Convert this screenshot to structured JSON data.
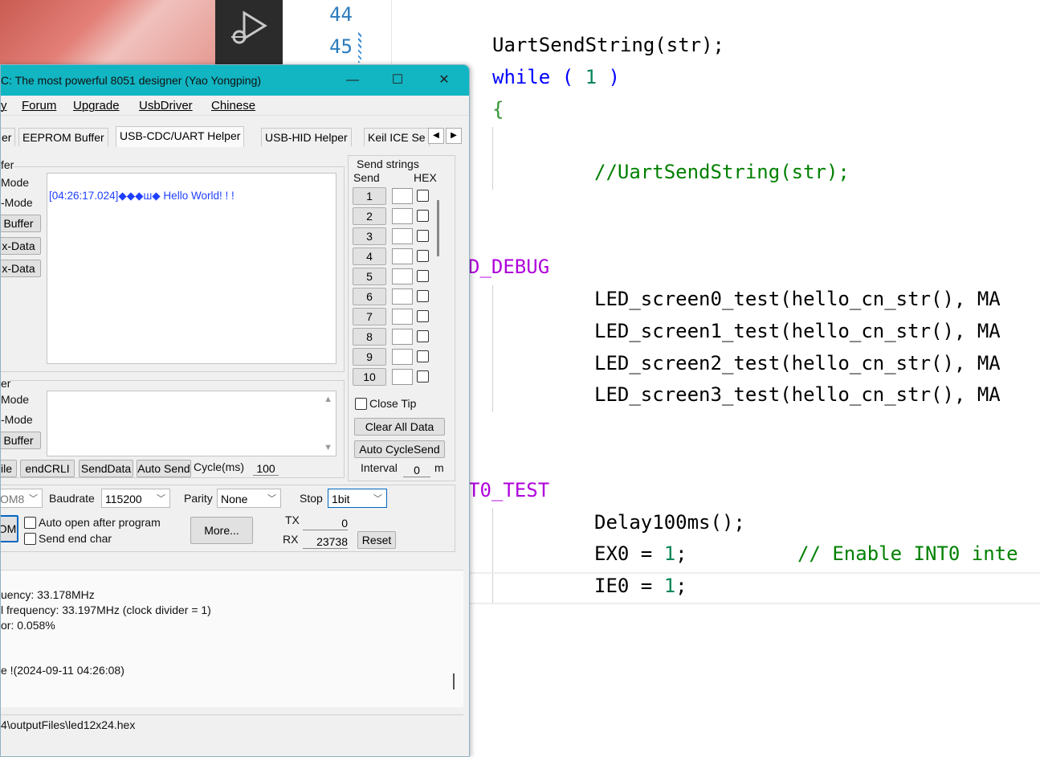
{
  "editor": {
    "gutter": [
      "44",
      "45"
    ],
    "lines": {
      "l1_fn": "UartSendString",
      "l1_arg": "(str);",
      "l2_kw": "while",
      "l2_open": " ( ",
      "l2_num": "1",
      "l2_close": " )",
      "l3_brace": "{",
      "l4_comment": "//UartSendString(str);",
      "l5_macro": "D_DEBUG",
      "l6": "LED_screen0_test",
      "l7": "LED_screen1_test",
      "l8": "LED_screen2_test",
      "l9": "LED_screen3_test",
      "lcall_a": "(hello_cn_str(), MA",
      "l10_macro": "T0_TEST",
      "l11": "Delay100ms();",
      "l12_a": "EX0 = ",
      "l12_num": "1",
      "l12_b": ";",
      "l12_comment": "// Enable INT0 inte",
      "l13_a": "IE0 = ",
      "l13_num": "1",
      "l13_b": ";"
    }
  },
  "window": {
    "title": "C: The most powerful 8051 designer (Yao Yongping)",
    "minimize": "—",
    "maximize": "☐",
    "close": "✕"
  },
  "menu": [
    "y",
    "Forum",
    "Upgrade",
    "UsbDriver",
    "Chinese"
  ],
  "tabs": [
    "er",
    "EEPROM Buffer",
    "USB-CDC/UART Helper",
    "USB-HID Helper",
    "Keil ICE Se"
  ],
  "receive": {
    "group_label": "fer",
    "opts": [
      "Mode",
      "-Mode"
    ],
    "buttons": [
      "Buffer",
      "x-Data",
      "x-Data"
    ],
    "content": "[04:26:17.024]◆◆◆ш◆ Hello World! ! !"
  },
  "send": {
    "group_label": "er",
    "opts": [
      "Mode",
      "-Mode"
    ],
    "button": "Buffer",
    "bottom_buttons": [
      "ile",
      "endCRLI",
      "SendData",
      "Auto Send"
    ],
    "cycle_label": "Cycle(ms)",
    "cycle_value": "100"
  },
  "send_strings": {
    "title": "Send strings",
    "col_send": "Send",
    "col_hex": "HEX",
    "rows": [
      "1",
      "2",
      "3",
      "4",
      "5",
      "6",
      "7",
      "8",
      "9",
      "10"
    ],
    "close_tip": "Close Tip",
    "clear_all": "Clear All Data",
    "auto_cycle": "Auto CycleSend",
    "interval_label": "Interval",
    "interval_value": "0",
    "interval_unit": "m"
  },
  "port": {
    "com": "OM8",
    "baud_label": "Baudrate",
    "baud_value": "115200",
    "parity_label": "Parity",
    "parity_value": "None",
    "stop_label": "Stop",
    "stop_value": "1bit",
    "open_button": "OM",
    "auto_open": "Auto open after program",
    "send_end": "Send end char",
    "more": "More...",
    "tx_label": "TX",
    "tx_value": "0",
    "rx_label": "RX",
    "rx_value": "23738",
    "reset": "Reset"
  },
  "log": [
    "uency: 33.178MHz",
    "l frequency: 33.197MHz (clock divider = 1)",
    "or: 0.058%",
    "e !(2024-09-11 04:26:08)"
  ],
  "path": "4\\outputFiles\\led12x24.hex"
}
